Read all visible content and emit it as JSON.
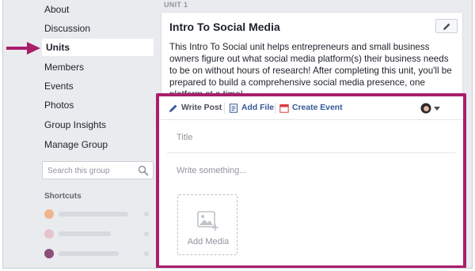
{
  "sidebar": {
    "items": [
      {
        "label": "About"
      },
      {
        "label": "Discussion"
      },
      {
        "label": "Units"
      },
      {
        "label": "Members"
      },
      {
        "label": "Events"
      },
      {
        "label": "Photos"
      },
      {
        "label": "Group Insights"
      },
      {
        "label": "Manage Group"
      }
    ],
    "active_item": "Units",
    "search": {
      "placeholder": "Search this group",
      "icon": "search-icon"
    },
    "shortcuts_heading": "Shortcuts"
  },
  "unit": {
    "label": "UNIT 1",
    "title": "Intro To Social Media",
    "description": "This Intro To Social unit helps entrepreneurs and small business owners figure out what social media platform(s) their business needs to be on without hours of research! After completing this unit, you'll be prepared to build a comprehensive social media presence, one platform at a time!"
  },
  "composer": {
    "tabs": [
      {
        "label": "Write Post",
        "icon": "pencil-icon"
      },
      {
        "label": "Add File",
        "icon": "file-icon"
      },
      {
        "label": "Create Event",
        "icon": "calendar-icon"
      }
    ],
    "title_placeholder": "Title",
    "body_placeholder": "Write something...",
    "add_media_label": "Add Media"
  },
  "colors": {
    "highlight": "#a91e6b",
    "link": "#365899",
    "background": "#e9ebee"
  }
}
